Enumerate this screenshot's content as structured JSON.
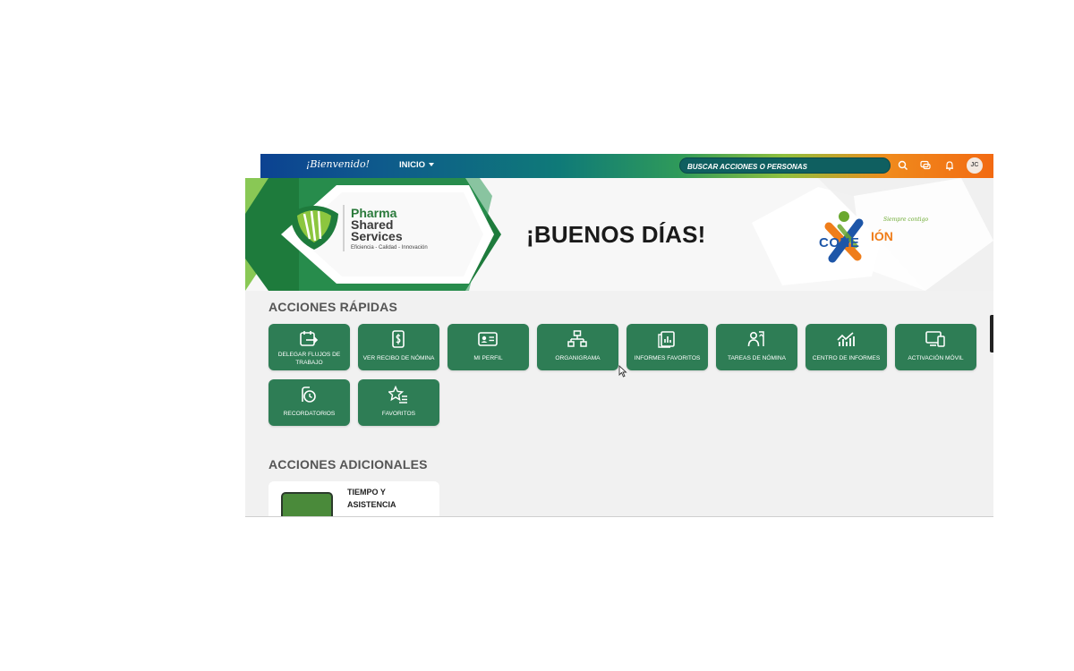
{
  "topbar": {
    "welcome": "¡Bienvenido!",
    "nav_label": "INICIO",
    "search_placeholder": "BUSCAR ACCIONES O PERSONAS",
    "avatar_initials": "JC",
    "icons": [
      "search-icon",
      "chat-icon",
      "bell-icon"
    ]
  },
  "banner": {
    "greeting": "¡BUENOS DÍAS!",
    "brand_line1": "Pharma",
    "brand_line2": "Shared",
    "brand_line3": "Services",
    "brand_tagline": "Eficiencia - Calidad - Innovación",
    "conexion_part1": "CONE",
    "conexion_part2": "IÓN",
    "conexion_tagline": "Siempre contigo"
  },
  "quick_actions": {
    "title": "ACCIONES RÁPIDAS",
    "items": [
      {
        "label": "DELEGAR FLUJOS DE TRABAJO",
        "icon": "calendar-arrow-icon"
      },
      {
        "label": "VER RECIBO DE NÓMINA",
        "icon": "dollar-receipt-icon"
      },
      {
        "label": "MI PERFIL",
        "icon": "id-card-icon"
      },
      {
        "label": "ORGANIGRAMA",
        "icon": "org-chart-icon"
      },
      {
        "label": "INFORMES FAVORITOS",
        "icon": "report-chart-icon"
      },
      {
        "label": "TAREAS DE NÓMINA",
        "icon": "person-task-icon"
      },
      {
        "label": "CENTRO DE INFORMES",
        "icon": "analytics-icon"
      },
      {
        "label": "ACTIVACIÓN MÓVIL",
        "icon": "mobile-devices-icon"
      },
      {
        "label": "RECORDATORIOS",
        "icon": "reminder-clock-icon"
      },
      {
        "label": "FAVORITOS",
        "icon": "star-list-icon"
      }
    ]
  },
  "additional_actions": {
    "title": "ACCIONES ADICIONALES",
    "card": {
      "title_line1": "TIEMPO Y",
      "title_line2": "ASISTENCIA",
      "icon": "calendar-icon"
    }
  },
  "colors": {
    "tile_green": "#2e7d55",
    "topbar_start": "#0c3f92",
    "topbar_end": "#f26a12",
    "page_bg": "#f1f1f1"
  }
}
